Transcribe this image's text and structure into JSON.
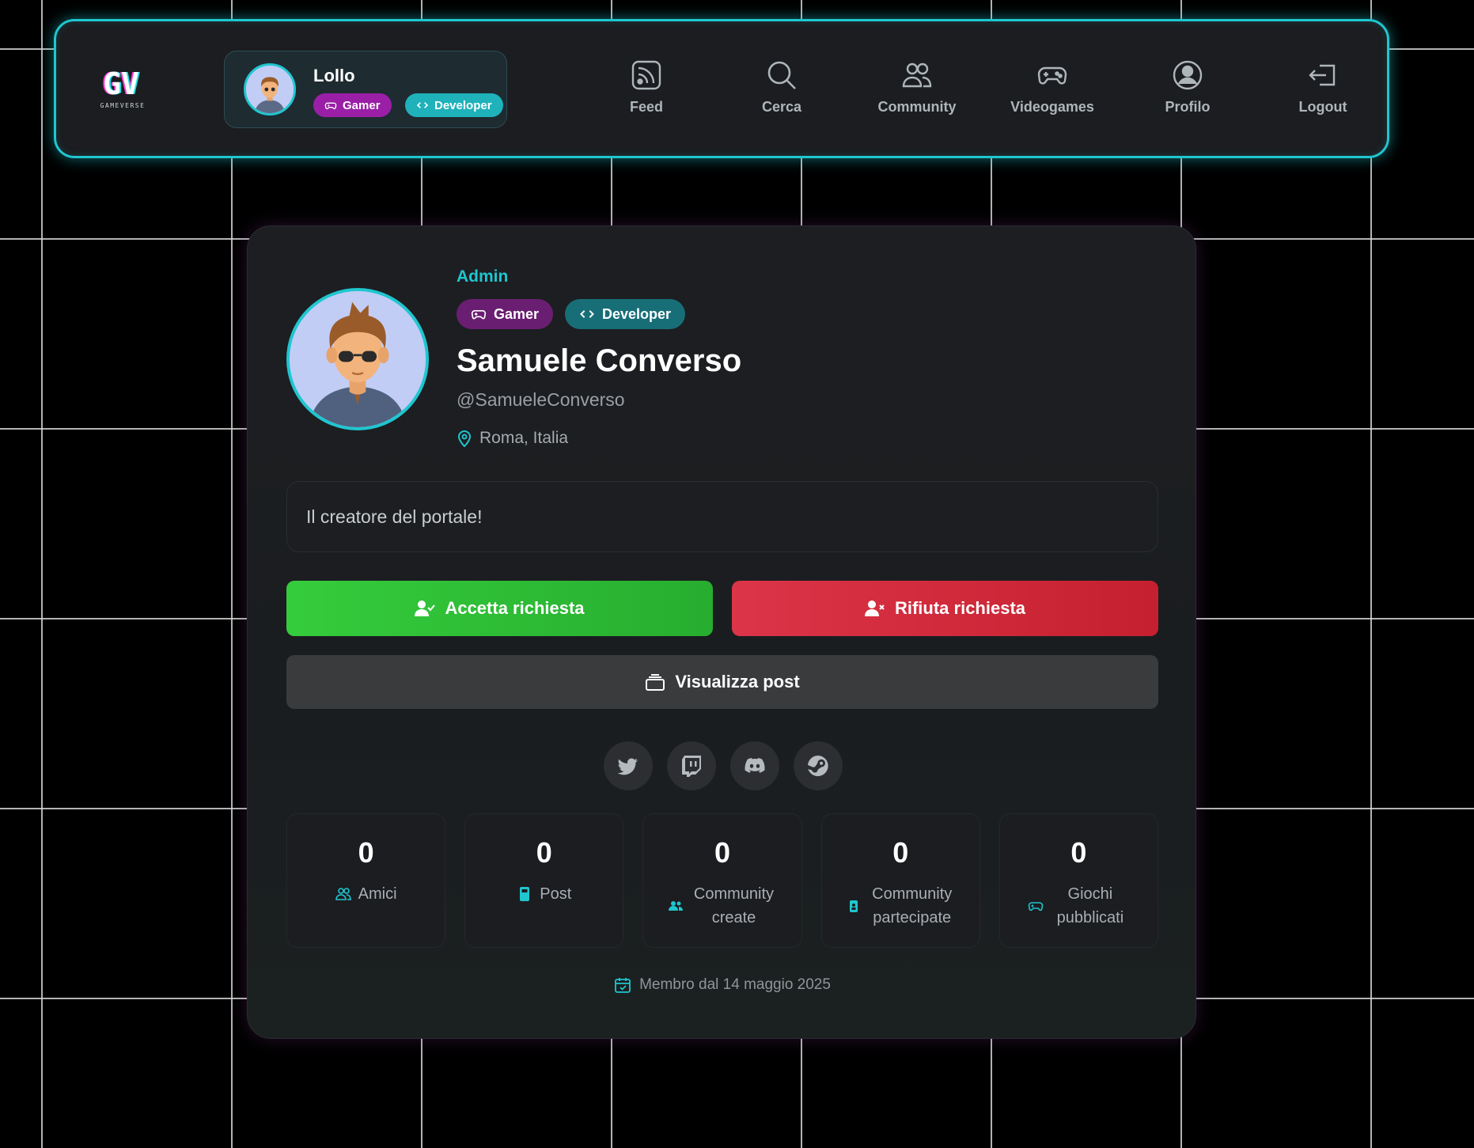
{
  "nav": {
    "logo_text": "GV",
    "logo_subtitle": "GAMEVERSE",
    "user": {
      "name": "Lollo",
      "badges": [
        {
          "label": "Gamer",
          "icon": "gamepad-icon",
          "color": "#9a1fa6"
        },
        {
          "label": "Developer",
          "icon": "code-icon",
          "color": "#1fb2bb"
        }
      ]
    },
    "items": [
      {
        "label": "Feed",
        "icon": "rss-icon"
      },
      {
        "label": "Cerca",
        "icon": "search-icon"
      },
      {
        "label": "Community",
        "icon": "people-icon"
      },
      {
        "label": "Videogames",
        "icon": "controller-icon"
      },
      {
        "label": "Profilo",
        "icon": "person-circle-icon"
      },
      {
        "label": "Logout",
        "icon": "logout-icon"
      }
    ]
  },
  "profile": {
    "role": "Admin",
    "badges": [
      {
        "label": "Gamer",
        "icon": "gamepad-icon",
        "color": "#6a1e71"
      },
      {
        "label": "Developer",
        "icon": "code-icon",
        "color": "#176e77"
      }
    ],
    "full_name": "Samuele Converso",
    "handle": "@SamueleConverso",
    "location": "Roma, Italia",
    "bio": "Il creatore del portale!",
    "actions": {
      "accept": "Accetta richiesta",
      "reject": "Rifiuta richiesta",
      "view_posts": "Visualizza post"
    },
    "socials": [
      "twitter-icon",
      "twitch-icon",
      "discord-icon",
      "steam-icon"
    ],
    "stats": [
      {
        "value": "0",
        "label": "Amici",
        "icon": "people-icon"
      },
      {
        "value": "0",
        "label": "Post",
        "icon": "post-icon"
      },
      {
        "value": "0",
        "label": "Community create",
        "icon": "users-icon"
      },
      {
        "value": "0",
        "label": "Community partecipate",
        "icon": "badge-icon"
      },
      {
        "value": "0",
        "label": "Giochi pubblicati",
        "icon": "gamepad-icon"
      }
    ],
    "member_since": "Membro dal 14 maggio 2025"
  },
  "colors": {
    "accent": "#1fc6cf",
    "accept": "#30c138",
    "reject": "#d42a3b",
    "background": "#000000"
  }
}
